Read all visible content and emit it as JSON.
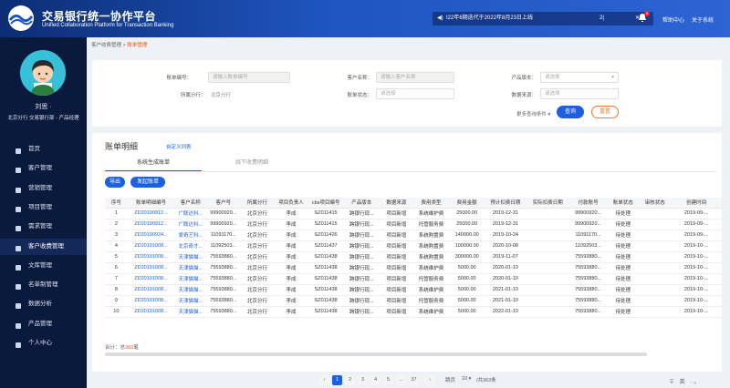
{
  "header": {
    "title_cn": "交易银行统一协作平台",
    "title_en": "Unified Collaboration Platform for Transaction Banking",
    "notice": "I22年6期迭代于2022年8月23日上线",
    "notice_count": "2(",
    "bell_badge": "9",
    "help": "帮助中心",
    "about": "关于系统"
  },
  "user": {
    "name": "刘思 ·",
    "org": "北京分行 交易银行部 - 产品经理"
  },
  "menu": [
    "首页",
    "客户管理",
    "营销管理",
    "项目管理",
    "需求管理",
    "客户收费管理",
    "文库管理",
    "名单制管理",
    "数据分析",
    "产品管理",
    "个人中心"
  ],
  "menu_active": 5,
  "breadcrumb": {
    "parent": "客户收费管理",
    "sep": ">",
    "current": "账单管理"
  },
  "filters": {
    "bill_no": {
      "label": "账单编号：",
      "placeholder": "请输入账单编号"
    },
    "customer": {
      "label": "客户名称：",
      "placeholder": "请输入客户名称"
    },
    "version": {
      "label": "产品版本：",
      "placeholder": "请选择"
    },
    "branch": {
      "label": "所属分行：",
      "value": "北京分行"
    },
    "status": {
      "label": "账单状态：",
      "placeholder": "请选择"
    },
    "source": {
      "label": "数据来源：",
      "placeholder": "请选择"
    },
    "more": "更多查询条件 ▾",
    "query": "查询",
    "reset": "重置"
  },
  "panel": {
    "title": "账单明细",
    "custom": "自定义列表",
    "tab1": "系统生成账单",
    "tab2": "线下收费明细",
    "export": "导出",
    "initiate": "发起账单"
  },
  "table": {
    "headers": [
      "序号",
      "账单明细编号",
      "客户名称",
      "客户号",
      "所属分行",
      "项目负责人",
      "cbs项目编号",
      "产品版本",
      "数据来源",
      "费用类型",
      "费用金额",
      "预计扣费日期",
      "实际扣费日期",
      "付款账号",
      "账单状态",
      "审核状态",
      "创建时间"
    ],
    "rows": [
      [
        "1",
        "ZD20190912...",
        "广联达科...",
        "99900920...",
        "北京分行",
        "李成",
        "SZ011415",
        "跨银行现...",
        "项目新增",
        "系统维护费",
        "25000.00",
        "2019-12-31",
        "",
        "99900920...",
        "待处理",
        "",
        "2019-09-..."
      ],
      [
        "2",
        "ZD20190912...",
        "广联达科...",
        "99900920...",
        "北京分行",
        "李成",
        "SZ011415",
        "跨银行现...",
        "项目新增",
        "托管服务费",
        "25000.00",
        "2019-12-31",
        "",
        "99900920...",
        "待处理",
        "",
        "2019-09-..."
      ],
      [
        "3",
        "ZD20190924...",
        "爱奇艺科...",
        "11091170...",
        "北京分行",
        "李成",
        "SZ011426",
        "跨银行现...",
        "项目新增",
        "系统购置费",
        "140000.00",
        "2019-10-24",
        "",
        "11091170...",
        "待处理",
        "",
        "2019-09-..."
      ],
      [
        "4",
        "ZD20191008...",
        "北京奇才...",
        "11092503...",
        "北京分行",
        "李成",
        "SZ011437",
        "跨银行现...",
        "项目新增",
        "系统购置费",
        "100000.00",
        "2020-10-08",
        "",
        "11092503...",
        "待处理",
        "",
        "2019-10-..."
      ],
      [
        "5",
        "ZD20191008...",
        "天津猫猫...",
        "75593880...",
        "北京分行",
        "李成",
        "SZ011438",
        "跨银行现...",
        "项目新增",
        "系统购置费",
        "300000.00",
        "2019-11-07",
        "",
        "75593880...",
        "待处理",
        "",
        "2019-10-..."
      ],
      [
        "6",
        "ZD20191008...",
        "天津猫猫...",
        "75593880...",
        "北京分行",
        "李成",
        "SZ011438",
        "跨银行现...",
        "项目新增",
        "系统维护费",
        "5000.00",
        "2020-01-10",
        "",
        "75593880...",
        "待处理",
        "",
        "2019-10-..."
      ],
      [
        "7",
        "ZD20191008...",
        "天津猫猫...",
        "75593880...",
        "北京分行",
        "李成",
        "SZ011438",
        "跨银行现...",
        "项目新增",
        "托管服务费",
        "5000.00",
        "2020-01-10",
        "",
        "75593880...",
        "待处理",
        "",
        "2019-10-..."
      ],
      [
        "8",
        "ZD20191008...",
        "天津猫猫...",
        "75593880...",
        "北京分行",
        "李成",
        "SZ011438",
        "跨银行现...",
        "项目新增",
        "系统维护费",
        "5000.00",
        "2021-01-10",
        "",
        "75593880...",
        "待处理",
        "",
        "2019-10-..."
      ],
      [
        "9",
        "ZD20191008...",
        "天津猫猫...",
        "75593880...",
        "北京分行",
        "李成",
        "SZ011438",
        "跨银行现...",
        "项目新增",
        "托管服务费",
        "5000.00",
        "2021-01-10",
        "",
        "75593880...",
        "待处理",
        "",
        "2019-10-..."
      ],
      [
        "10",
        "ZD20191008...",
        "天津猫猫...",
        "75593880...",
        "北京分行",
        "李成",
        "SZ011438",
        "跨银行现...",
        "项目新增",
        "系统维护费",
        "5000.00",
        "2022-01-10",
        "",
        "75593880...",
        "待处理",
        "",
        "2019-10-..."
      ]
    ]
  },
  "total": {
    "prefix": "合计：总",
    "count": "363",
    "suffix": "笔"
  },
  "pager": {
    "prev": "‹",
    "pages": [
      "1",
      "2",
      "3",
      "4",
      "5",
      "...",
      "37"
    ],
    "next": "›",
    "goto": "跳页",
    "size": "10 ▾",
    "total": "/共363条"
  },
  "footer_tools": "∓ 英 ·。"
}
